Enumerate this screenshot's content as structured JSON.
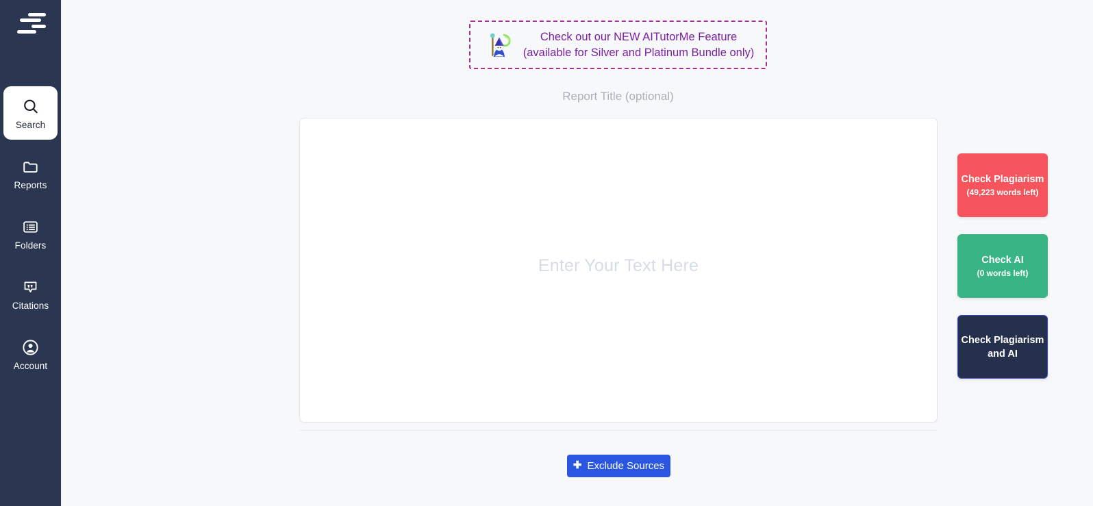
{
  "sidebar": {
    "logo_name": "plagiarism-checker-logo",
    "items": [
      {
        "label": "Search",
        "icon": "search-icon",
        "active": true
      },
      {
        "label": "Reports",
        "icon": "folder-icon",
        "active": false
      },
      {
        "label": "Folders",
        "icon": "list-icon",
        "active": false
      },
      {
        "label": "Citations",
        "icon": "quote-bubble-icon",
        "active": false
      },
      {
        "label": "Account",
        "icon": "user-circle-icon",
        "active": false
      }
    ]
  },
  "promo": {
    "icon": "wizard-icon",
    "line1": "Check out our NEW AITutorMe Feature",
    "line2": "(available for Silver and Platinum Bundle only)",
    "text_color": "#7a1fa2",
    "border_color": "#a4308f"
  },
  "report_title": {
    "placeholder": "Report Title (optional)",
    "value": ""
  },
  "editor": {
    "placeholder": "Enter Your Text Here",
    "value": ""
  },
  "exclude": {
    "label": "Exclude Sources",
    "icon": "plus-icon",
    "color": "#2b56e2"
  },
  "actions": [
    {
      "title": "Check Plagiarism",
      "subtitle": "(49,223 words left)",
      "color": "#f6555d",
      "name": "check-plagiarism-button"
    },
    {
      "title": "Check AI",
      "subtitle": "(0 words left)",
      "color": "#39b484",
      "name": "check-ai-button"
    },
    {
      "title": "Check Plagiarism and AI",
      "subtitle": "",
      "color": "#24304c",
      "name": "check-plagiarism-and-ai-button"
    }
  ]
}
